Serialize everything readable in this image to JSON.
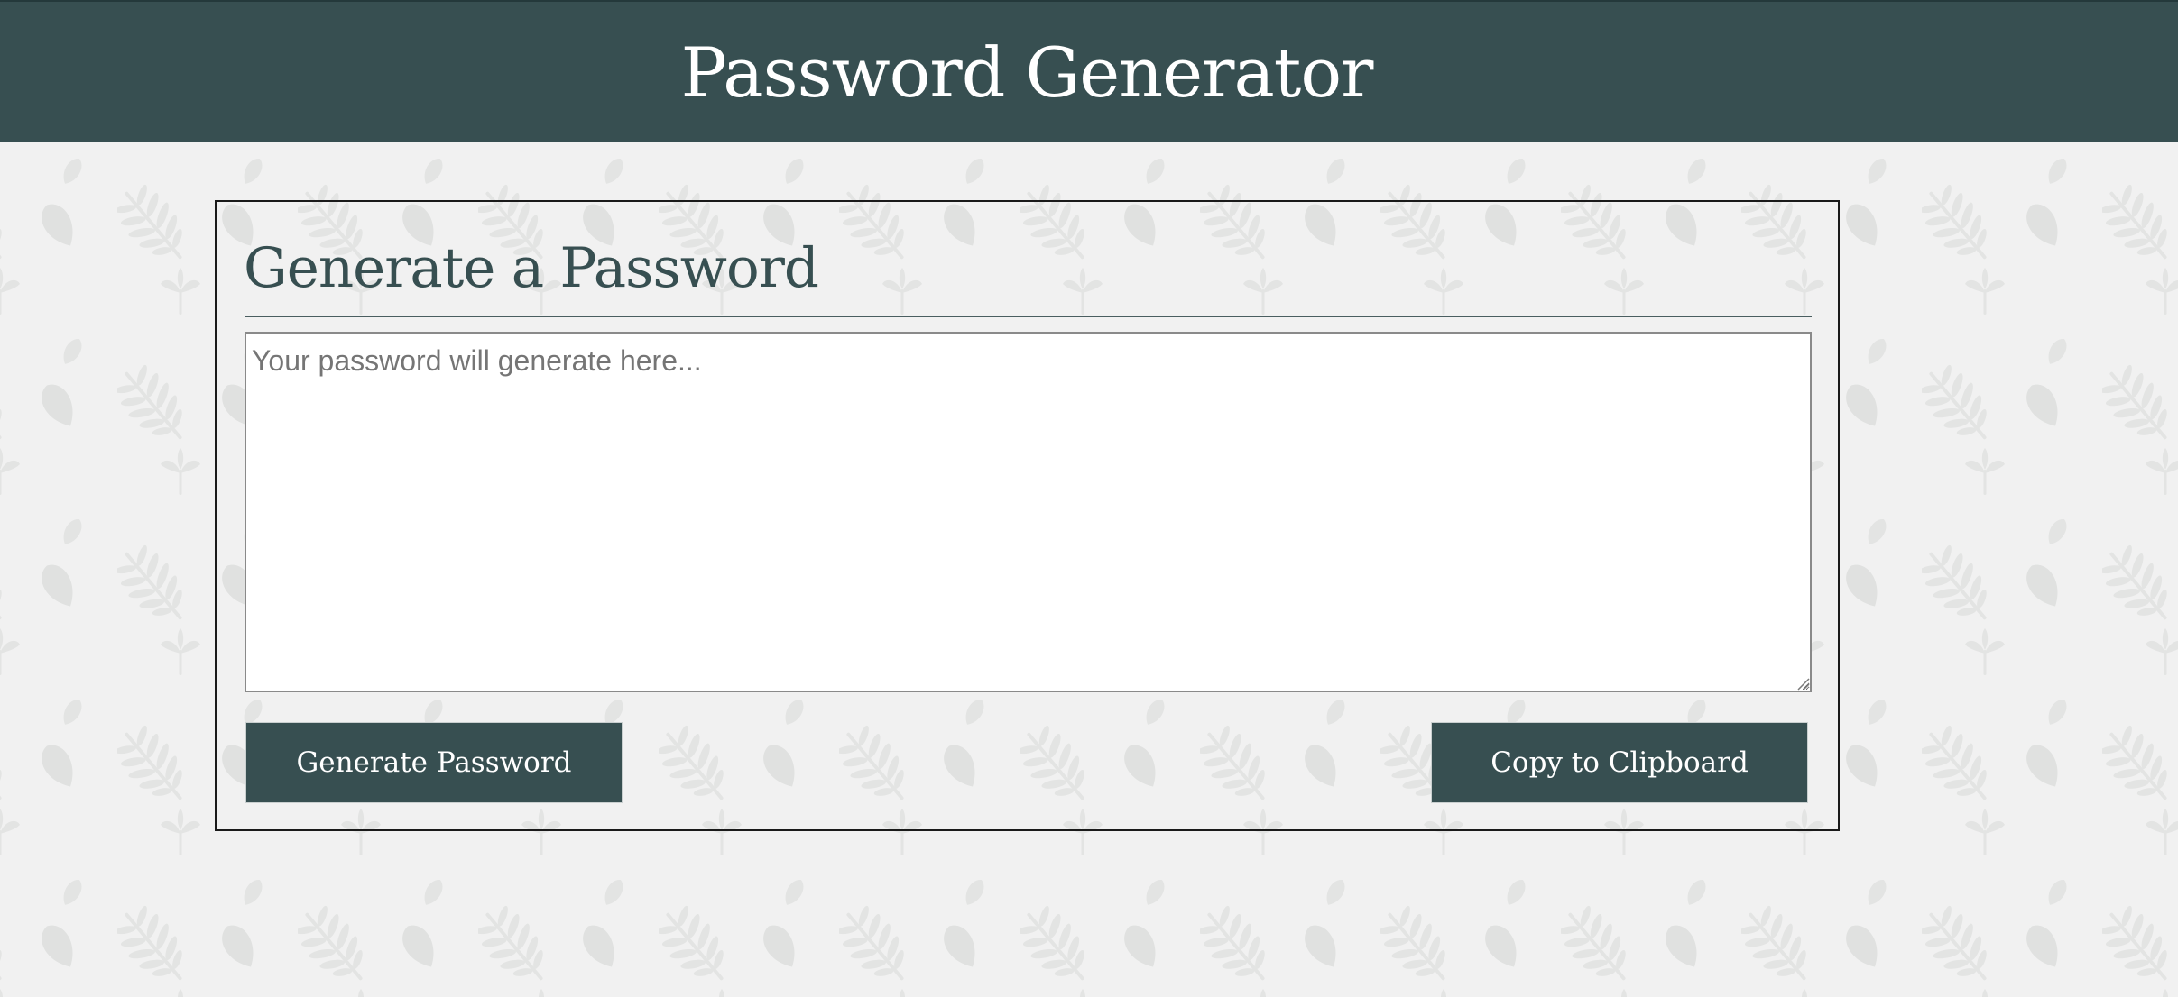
{
  "header": {
    "title": "Password Generator"
  },
  "card": {
    "title": "Generate a Password",
    "password_field": {
      "value": "",
      "placeholder": "Your password will generate here..."
    },
    "generate_button_label": "Generate Password",
    "copy_button_label": "Copy to Clipboard"
  },
  "colors": {
    "header_bg": "#374f51",
    "page_bg": "#f1f1f1",
    "button_bg": "#374f51",
    "accent_text": "#374f51",
    "leaf_pattern": "#e4e5e4"
  },
  "icons": {
    "background": "leaf-pattern",
    "resize": "textarea-resize-grip-icon"
  }
}
